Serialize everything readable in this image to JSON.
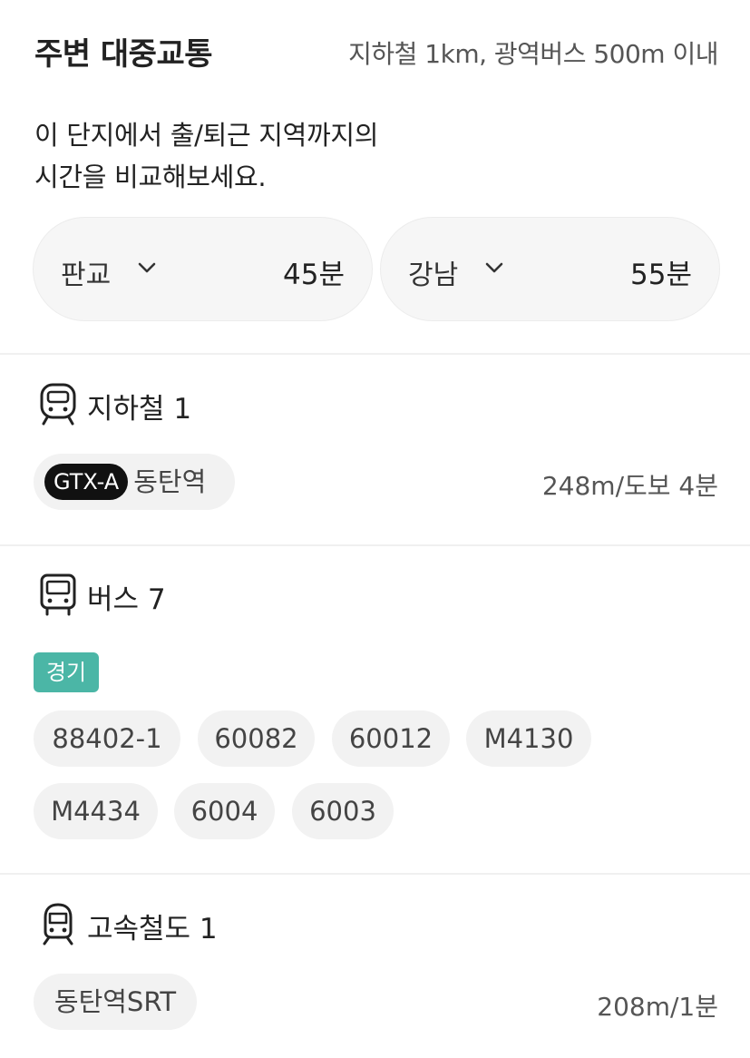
{
  "header": {
    "title": "주변 대중교통",
    "subtitle": "지하철 1km, 광역버스 500m 이내"
  },
  "compare": {
    "line1": "이 단지에서 출/퇴근 지역까지의",
    "line2": "시간을 비교해보세요."
  },
  "destinations": [
    {
      "name": "판교",
      "time": "45분",
      "icon": "chevron-down-icon"
    },
    {
      "name": "강남",
      "time": "55분",
      "icon": "chevron-down-icon"
    }
  ],
  "subway": {
    "label": "지하철 1",
    "icon": "subway-icon",
    "station": {
      "line": "GTX-A",
      "name": "동탄역",
      "distance": "248m/도보 4분"
    }
  },
  "bus": {
    "label": "버스 7",
    "icon": "bus-icon",
    "region": "경기",
    "region_color": "#4bb6a6",
    "routes": [
      "88402-1",
      "60082",
      "60012",
      "M4130",
      "M4434",
      "6004",
      "6003"
    ]
  },
  "train": {
    "label": "고속철도 1",
    "icon": "high-speed-train-icon",
    "station": {
      "name": "동탄역SRT",
      "distance": "208m/1분"
    }
  }
}
